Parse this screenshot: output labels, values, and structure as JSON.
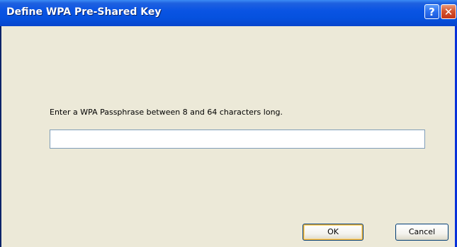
{
  "window": {
    "title": "Define WPA Pre-Shared Key",
    "help_label": "?",
    "close_label": "✕"
  },
  "form": {
    "prompt": "Enter a WPA Passphrase between 8 and 64 characters long.",
    "passphrase_value": ""
  },
  "buttons": {
    "ok_label": "OK",
    "cancel_label": "Cancel"
  },
  "colors": {
    "titlebar": "#0a54e3",
    "dialog_bg": "#ece9d8",
    "close_button": "#d6552f"
  }
}
